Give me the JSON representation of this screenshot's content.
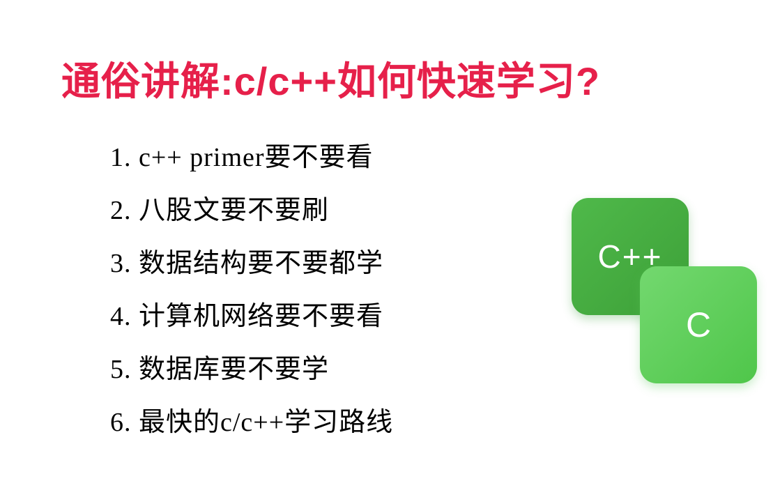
{
  "title": "通俗讲解:c/c++如何快速学习?",
  "list": {
    "items": [
      "1. c++ primer要不要看",
      "2. 八股文要不要刷",
      "3. 数据结构要不要都学",
      "4. 计算机网络要不要看",
      "5. 数据库要不要学",
      "6. 最快的c/c++学习路线"
    ]
  },
  "icons": {
    "cpp_label": "C++",
    "c_label": "C"
  },
  "colors": {
    "title": "#e6204a",
    "text": "#000000",
    "icon_cpp_start": "#4fb94a",
    "icon_cpp_end": "#3da038",
    "icon_c_start": "#73d86f",
    "icon_c_end": "#4fc64a"
  }
}
